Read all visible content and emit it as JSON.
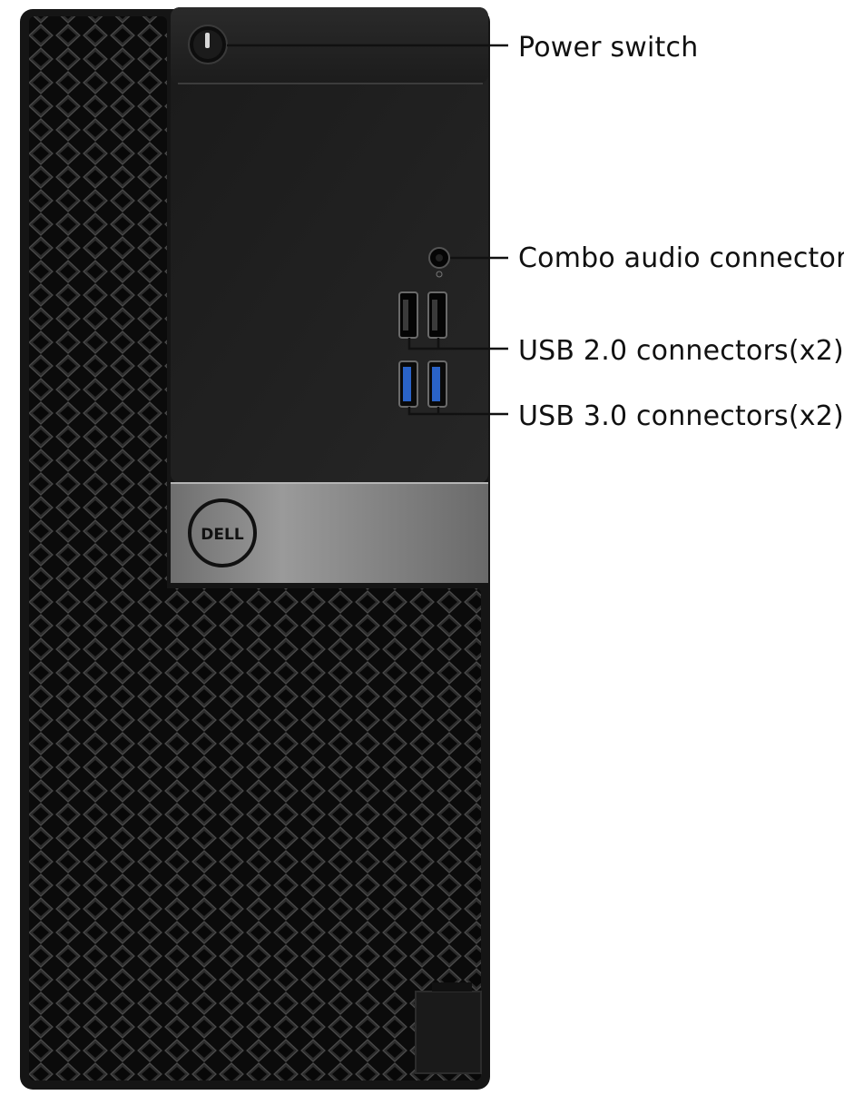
{
  "image": {
    "brand_logo_text": "DELL",
    "colors": {
      "tower_body": "#151515",
      "mesh_hole": "#0c0c0c",
      "mesh_ridge": "#3a3a3a",
      "front_panel": "#1e1e1e",
      "silver_band": "#8e8e8e",
      "usb3_blue": "#2a63c8",
      "callout_line": "#111111"
    }
  },
  "callouts": {
    "power_switch": "Power switch",
    "combo_audio": "Combo audio connector",
    "usb2": "USB 2.0 connectors(x2)",
    "usb3": "USB 3.0 connectors(x2)"
  }
}
